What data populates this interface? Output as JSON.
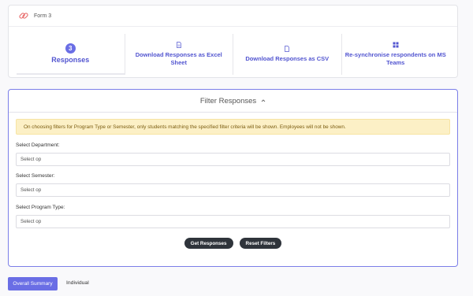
{
  "form": {
    "title": "Form 3"
  },
  "tiles": {
    "responses_count": "3",
    "responses_label": "Responses",
    "excel_label": "Download Responses as Excel Sheet",
    "csv_label": "Download Responses as CSV",
    "resync_label": "Re-synchronise respondents on MS Teams"
  },
  "filter": {
    "title": "Filter Responses",
    "notice": "On choosing filters for Program Type or Semester, only students matching the specified filter criteria will be shown. Employees will not be shown.",
    "department_label": "Select Department:",
    "department_value": "Select op",
    "semester_label": "Select Semester:",
    "semester_value": "Select op",
    "program_label": "Select Program Type:",
    "program_value": "Select op",
    "get_responses": "Get Responses",
    "reset_filters": "Reset Filters"
  },
  "tabs": {
    "overall_summary": "Overall Summary",
    "individual": "Individual"
  },
  "colors": {
    "accent": "#6a6ee5",
    "link": "#5255d0",
    "notice_bg": "#fcf0c6",
    "dark_button": "#2f343b"
  },
  "icons": {
    "form": "link-icon",
    "excel": "document-icon",
    "csv": "file-icon",
    "resync": "windows-icon",
    "collapse": "chevron-up-icon"
  }
}
